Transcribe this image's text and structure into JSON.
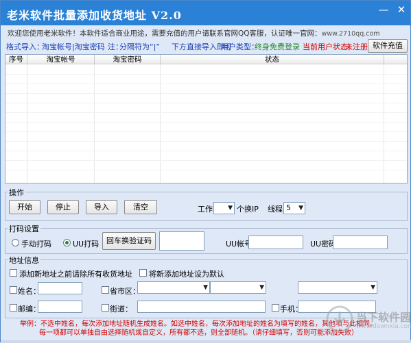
{
  "window": {
    "title": "老米软件批量添加收货地址 V2.0",
    "minimize_icon": "minimize-icon",
    "close_icon": "close-icon"
  },
  "welcome": {
    "text": "欢迎您使用老米软件！本软件适合商业用途，需要充值的用户请联系官网QQ客服，认证唯一官网：",
    "url": "www.2710qq.com"
  },
  "format_line": {
    "format_label": "格式导入：",
    "format_value": "淘宝帐号|淘宝密码",
    "note_label": "注：",
    "separator_note": "分隔符为“|”",
    "direct_import": "下方直接导入即可",
    "user_type_label": "用户类型：",
    "user_type_value": "终身免费登录",
    "status_label": "当前用户状态：",
    "status_value": "未注册",
    "recharge_button": "软件充值"
  },
  "table": {
    "columns": [
      "序号",
      "淘宝帐号",
      "淘宝密码",
      "状态"
    ],
    "rows": []
  },
  "operation": {
    "legend": "操作",
    "buttons": [
      "开始",
      "停止",
      "导入",
      "清空"
    ],
    "work_label": "工作",
    "work_value": "",
    "ip_label": "个换IP",
    "thread_label": "线程",
    "thread_value": "5"
  },
  "captcha": {
    "legend": "打码设置",
    "manual_label": "手动打码",
    "uu_label": "UU打码",
    "selected": "UU打码",
    "refresh_button": "回车换验证码",
    "uu_account_label": "UU帐号",
    "uu_password_label": "UU密码"
  },
  "address": {
    "legend": "地址信息",
    "clear_before_add": "添加新地址之前请除所有收货地址",
    "set_default": "将新添加地址设为默认",
    "name_label": "姓名：",
    "region_label": "省市区：",
    "zip_label": "邮编：",
    "street_label": "街道：",
    "phone_label": "手机："
  },
  "note": {
    "line1": "举例：不选中姓名，每次添加地址随机生成姓名。如选中姓名，每次添加地址的姓名为填写的姓名，其他项与此相同。",
    "line2": "每一项都可以单独自由选择随机或自定义，所有都不选，则全部随机。（请仔细填写，否则可能添加失败）"
  },
  "watermark": {
    "title": "当下软件园",
    "subtitle": "www.downxia.com"
  },
  "colors": {
    "titlebar": "#2b81d6",
    "window_bg": "#dfe8f6",
    "accent_blue": "#1a3fb5",
    "accent_red": "#d10000",
    "accent_green": "#218a2a"
  }
}
